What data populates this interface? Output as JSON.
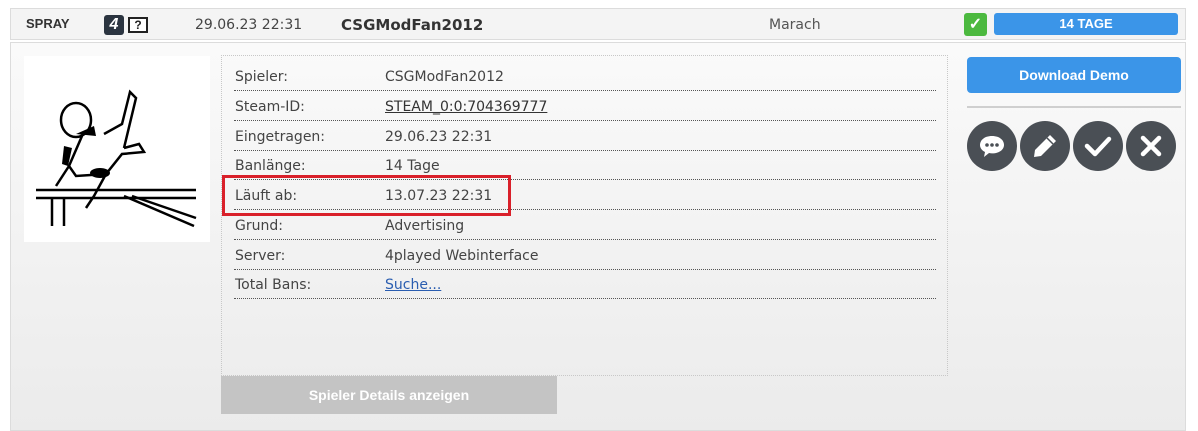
{
  "header": {
    "type": "SPRAY",
    "game_icon": "4",
    "unknown_icon": "?",
    "datetime": "29.06.23 22:31",
    "player": "CSGModFan2012",
    "admin": "Marach",
    "duration_badge": "14 TAGE"
  },
  "details": {
    "rows": [
      {
        "label": "Spieler:",
        "value": "CSGModFan2012"
      },
      {
        "label": "Steam-ID:",
        "value": "STEAM_0:0:704369777"
      },
      {
        "label": "Eingetragen:",
        "value": "29.06.23 22:31"
      },
      {
        "label": "Banlänge:",
        "value": "14 Tage"
      },
      {
        "label": "Läuft ab:",
        "value": "13.07.23 22:31"
      },
      {
        "label": "Grund:",
        "value": "Advertising"
      },
      {
        "label": "Server:",
        "value": "4played Webinterface"
      },
      {
        "label": "Total Bans:",
        "value": "Suche..."
      }
    ],
    "show_details_label": "Spieler Details anzeigen"
  },
  "actions": {
    "download_demo_label": "Download Demo",
    "icons": [
      "comment-icon",
      "edit-icon",
      "check-icon",
      "close-icon"
    ]
  },
  "colors": {
    "accent": "#3b95e8",
    "success": "#4cb93f",
    "highlight": "#d9202a",
    "action_circle": "#4a4f55"
  }
}
